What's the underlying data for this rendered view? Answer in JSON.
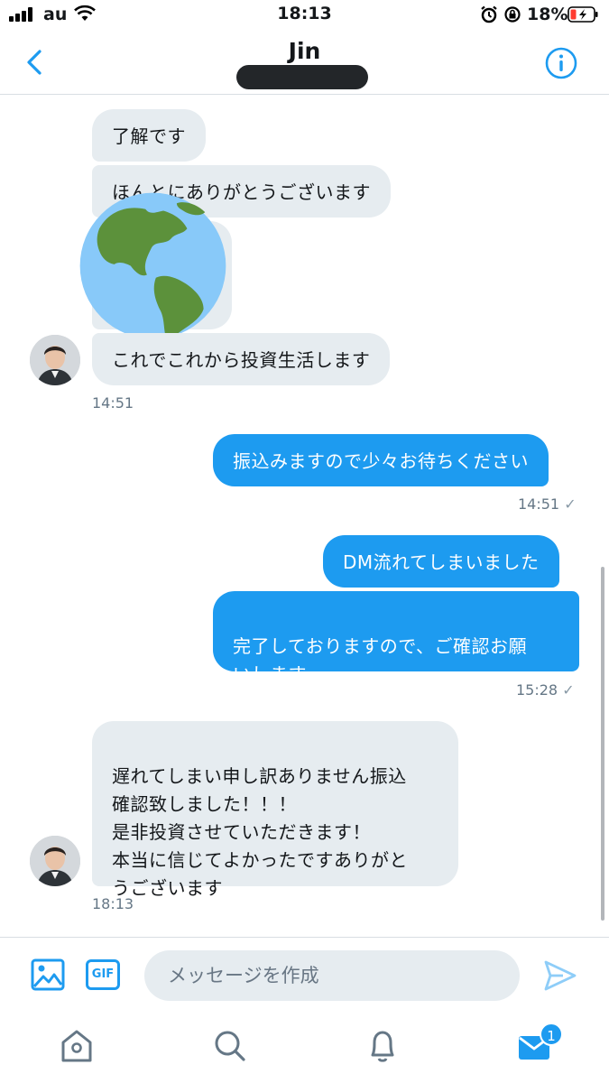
{
  "status_bar": {
    "carrier": "au",
    "time": "18:13",
    "battery_percent": "18%"
  },
  "header": {
    "contact_name": "Jin"
  },
  "messages": [
    {
      "text": "了解です"
    },
    {
      "text": "ほんとにありがとうございます"
    },
    {
      "text": "これでこれから投資生活します"
    },
    {
      "text": "振込みますので少々お待ちください"
    },
    {
      "text": "DM流れてしまいました"
    },
    {
      "text": "完了しておりますので、ご確認お願\nいします"
    },
    {
      "text": "遅れてしまい申し訳ありません振込\n確認致しました！！！\n是非投資させていただきます！\n本当に信じてよかったですありがと\nうございます"
    }
  ],
  "timestamps": {
    "t1": "14:51",
    "t2": "14:51",
    "t3": "15:28",
    "t4": "18:13"
  },
  "read_mark": "✓",
  "composer": {
    "placeholder": "メッセージを作成",
    "gif_label": "GIF"
  },
  "tabbar": {
    "messages_badge": "1"
  },
  "colors": {
    "accent": "#1d9bf0",
    "incoming_bubble": "#e6ecf0",
    "globe_ocean": "#88c9f9",
    "globe_land": "#5c913b"
  },
  "icons": [
    "back-icon",
    "info-icon",
    "image-icon",
    "gif-icon",
    "send-icon",
    "home-icon",
    "search-icon",
    "bell-icon",
    "mail-icon",
    "globe-emoji-icon"
  ]
}
